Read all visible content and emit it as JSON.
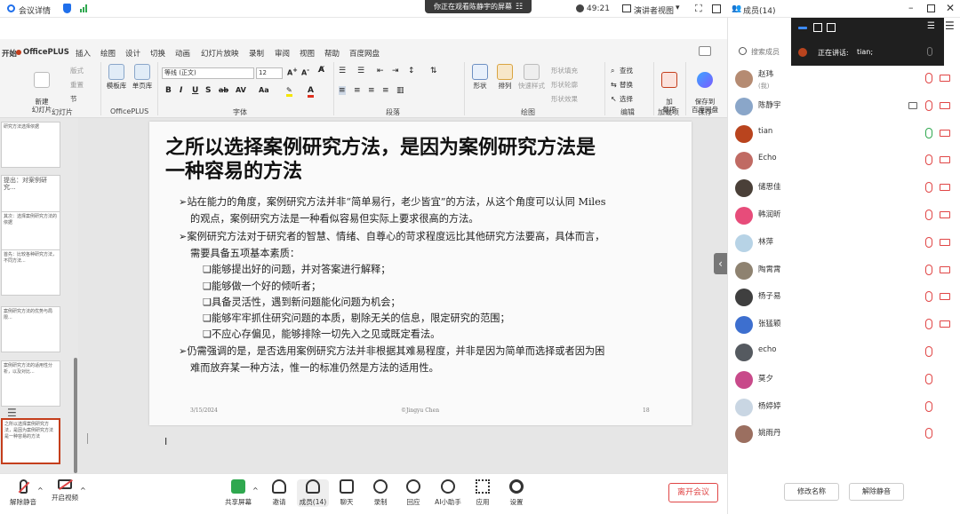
{
  "topbar": {
    "meeting_details": "会议详情",
    "share_banner": "你正在观看陈静宇的屏幕",
    "banner_icon": "tiles-icon",
    "timer": "49:21",
    "view_mode": "演讲者视图",
    "members_title": "成员(14)"
  },
  "ppt": {
    "app_tab": "OfficePLUS",
    "tabs": [
      "开始",
      "插入",
      "绘图",
      "设计",
      "切换",
      "动画",
      "幻灯片放映",
      "录制",
      "审阅",
      "视图",
      "帮助",
      "百度网盘"
    ],
    "ribbon": {
      "new_slide": "新建\n幻灯片",
      "layout": "版式",
      "reset": "重置",
      "section": "节",
      "group_slides": "幻灯片",
      "template_lib": "模板库",
      "single_page": "单页库",
      "group_officeplus": "OfficePLUS",
      "font_name": "等线 (正文)",
      "font_size": "12",
      "group_font": "字体",
      "group_paragraph": "段落",
      "shape": "形状",
      "arrange": "排列",
      "quick_style": "快速样式",
      "shape_fill": "形状填充",
      "shape_outline": "形状轮廓",
      "shape_effect": "形状效果",
      "group_drawing": "绘图",
      "find": "查找",
      "replace": "替换",
      "select": "选择",
      "group_edit": "编辑",
      "addin": "加\n载项",
      "group_addin": "加载项",
      "save_baidu": "保存到\n百度网盘",
      "group_save": "保存"
    },
    "thumbnails": [
      "研究方法选择依据",
      "提出：对案例研究...",
      "其次：选择案例研究方法的依据",
      "首先：比较各种研究方法，不同方法...",
      "案例研究方法的优势与局限...",
      "案例研究方法的适用性分析，以及对比...",
      "之所以选择案例研究方法，是因为案例研究方法是一种容易的方法"
    ],
    "slide": {
      "title": "之所以选择案例研究方法，是因为案例研究方法是一种容易的方法",
      "title_line1": "之所以选择案例研究方法，是因为案例研究方法是",
      "title_line2": "一种容易的方法",
      "lines": [
        "➢站在能力的角度，案例研究方法并非“简单易行，老少皆宜”的方法，从这个角度可以认同 Miles",
        "的观点，案例研究方法是一种看似容易但实际上要求很高的方法。",
        "➢案例研究方法对于研究者的智慧、情绪、自尊心的苛求程度远比其他研究方法要高，具体而言，",
        "需要具备五项基本素质：",
        "❑能够提出好的问题，并对答案进行解释；",
        "❑能够做一个好的倾听者；",
        "❑具备灵活性，遇到新问题能化问题为机会；",
        "❑能够牢牢抓住研究问题的本质，剔除无关的信息，限定研究的范围；",
        "❑不应心存偏见，能够排除一切先入之见或既定看法。",
        "➢仍需强调的是，是否选用案例研究方法并非根据其难易程度，并非是因为简单而选择或者因为困",
        "难而放弃某一种方法，惟一的标准仍然是方法的适用性。"
      ],
      "footer_date": "3/15/2024",
      "footer_author": "©Jingyu Chen",
      "footer_page": "18"
    }
  },
  "bottom": {
    "mute": "解除静音",
    "video": "开启视频",
    "share": "共享屏幕",
    "invite": "邀请",
    "members": "成员(14)",
    "chat": "聊天",
    "record": "录制",
    "react": "回应",
    "ai": "AI小助手",
    "apps": "应用",
    "settings": "设置",
    "leave": "离开会议"
  },
  "members_panel": {
    "search_placeholder": "搜索成员",
    "speaking_label": "正在讲话:",
    "speaking_name": "tian;",
    "rename_button": "修改名称",
    "unmute_button": "解除静音",
    "members": [
      {
        "name": "赵玮",
        "sub": "(我)",
        "color": "#b58b72",
        "mic": "muted",
        "cam": "off"
      },
      {
        "name": "陈静宇",
        "sub": "",
        "color": "#8aa6c9",
        "mic": "muted",
        "cam": "off",
        "screen": true
      },
      {
        "name": "tian",
        "sub": "",
        "color": "#b9441e",
        "mic": "on",
        "cam": "off"
      },
      {
        "name": "Echo",
        "sub": "",
        "color": "#c06a63",
        "mic": "muted",
        "cam": "off"
      },
      {
        "name": "储思佳",
        "sub": "",
        "color": "#4a4038",
        "mic": "muted",
        "cam": "off"
      },
      {
        "name": "韩润昕",
        "sub": "",
        "color": "#e74c7a",
        "mic": "muted",
        "cam": "off"
      },
      {
        "name": "林萍",
        "sub": "",
        "color": "#b7d3e6",
        "mic": "muted",
        "cam": "off"
      },
      {
        "name": "陶霄霄",
        "sub": "",
        "color": "#8e8270",
        "mic": "muted",
        "cam": "off"
      },
      {
        "name": "杨子易",
        "sub": "",
        "color": "#3f3f3f",
        "mic": "muted",
        "cam": "off"
      },
      {
        "name": "张猛颖",
        "sub": "",
        "color": "#3d6fcf",
        "mic": "muted",
        "cam": "off"
      },
      {
        "name": "echo",
        "sub": "",
        "color": "#555a60",
        "mic": "muted",
        "cam": "none"
      },
      {
        "name": "莫夕",
        "sub": "",
        "color": "#c84a8a",
        "mic": "muted",
        "cam": "none"
      },
      {
        "name": "杨婷婷",
        "sub": "",
        "color": "#c9d6e3",
        "mic": "muted",
        "cam": "none"
      },
      {
        "name": "姚雨丹",
        "sub": "",
        "color": "#9b6f60",
        "mic": "muted",
        "cam": "none"
      }
    ]
  },
  "colors": {
    "accent": "#c43e1c",
    "muted": "#e04545",
    "ok": "#2fa84f",
    "blue": "#1f6feb"
  }
}
